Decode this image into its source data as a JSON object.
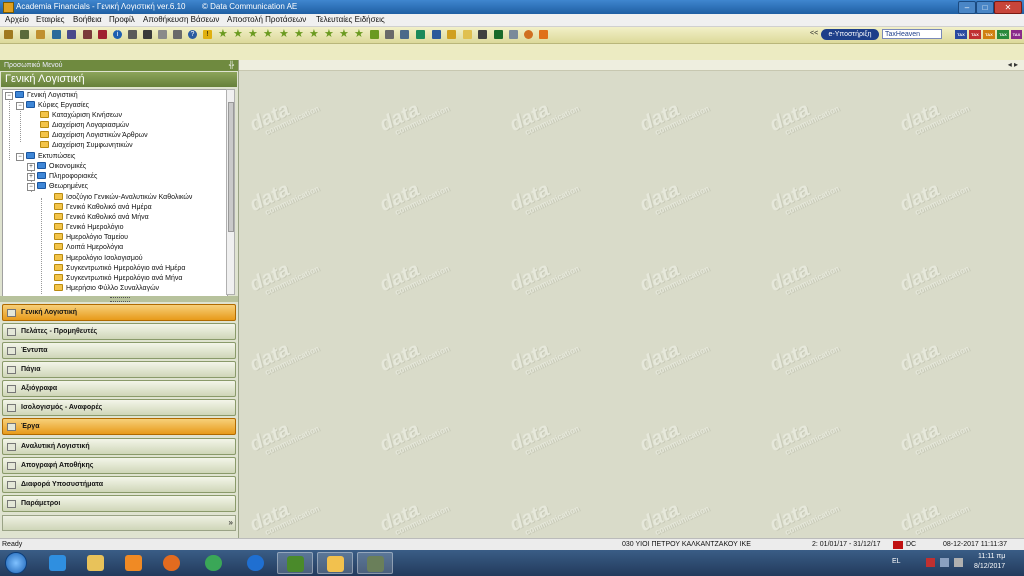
{
  "window": {
    "title": "Academia Financials - Γενική Λογιστική ver.6.10",
    "copyright": "© Data Communication AE",
    "buttons": {
      "minimize": "–",
      "maximize": "□",
      "close": "✕"
    }
  },
  "menu": [
    "Αρχείο",
    "Εταιρίες",
    "Βοήθεια",
    "Προφίλ",
    "Αποθήκευση Βάσεων",
    "Αποστολή Προτάσεων",
    "Τελευταίες Ειδήσεις"
  ],
  "toolbar": {
    "back_label": "<<",
    "ehelp_label": "e-Υποστήριξη",
    "taxheaven_label": "TaxHeaven",
    "tax_badges": [
      "TAX",
      "TAX",
      "TAX",
      "TAX",
      "TAX"
    ]
  },
  "panel": {
    "caption": "Προσωπικό Μενού",
    "pin": "╬",
    "title": "Γενική Λογιστική"
  },
  "tree": [
    {
      "label": "Γενική Λογιστική",
      "level": 0,
      "icon": "folder-blue",
      "expander": "−"
    },
    {
      "label": "Κύριες Εργασίες",
      "level": 1,
      "icon": "folder-blue",
      "expander": "−"
    },
    {
      "label": "Καταχώριση Κινήσεων",
      "level": 2,
      "icon": "folder-yellow"
    },
    {
      "label": "Διαχείριση Λογαριασμών",
      "level": 2,
      "icon": "folder-yellow"
    },
    {
      "label": "Διαχείριση Λογιστικών Άρθρων",
      "level": 2,
      "icon": "folder-yellow"
    },
    {
      "label": "Διαχείριση Συμφωνητικών",
      "level": 2,
      "icon": "folder-yellow"
    },
    {
      "label": "Εκτυπώσεις",
      "level": 1,
      "icon": "folder-blue",
      "expander": "−"
    },
    {
      "label": "Οικονομικές",
      "level": 2,
      "icon": "folder-blue",
      "expander": "+"
    },
    {
      "label": "Πληροφοριακές",
      "level": 2,
      "icon": "folder-blue",
      "expander": "+"
    },
    {
      "label": "Θεωρημένες",
      "level": 2,
      "icon": "folder-blue",
      "expander": "−"
    },
    {
      "label": "Ισοζύγιο Γενικών-Αναλυτικών Καθολικών",
      "level": 3,
      "icon": "folder-yellow"
    },
    {
      "label": "Γενικό Καθολικό ανά Ημέρα",
      "level": 3,
      "icon": "folder-yellow"
    },
    {
      "label": "Γενικό Καθολικό ανά Μήνα",
      "level": 3,
      "icon": "folder-yellow"
    },
    {
      "label": "Γενικό Ημερολόγιο",
      "level": 3,
      "icon": "folder-yellow"
    },
    {
      "label": "Ημερολόγιο Ταμείου",
      "level": 3,
      "icon": "folder-yellow"
    },
    {
      "label": "Λοιπά Ημερολόγια",
      "level": 3,
      "icon": "folder-yellow"
    },
    {
      "label": "Ημερολόγιο Ισολογισμού",
      "level": 3,
      "icon": "folder-yellow"
    },
    {
      "label": "Συγκεντρωτικό Ημερολόγιο ανά Ημέρα",
      "level": 3,
      "icon": "folder-yellow"
    },
    {
      "label": "Συγκεντρωτικό Ημερολόγιο ανά Μήνα",
      "level": 3,
      "icon": "folder-yellow"
    },
    {
      "label": "Ημερήσιο Φύλλο Συναλλαγών",
      "level": 3,
      "icon": "folder-yellow"
    }
  ],
  "nav_buttons": [
    {
      "label": "Γενική Λογιστική",
      "active": true
    },
    {
      "label": "Πελάτες - Προμηθευτές",
      "active": false
    },
    {
      "label": "Έντυπα",
      "active": false
    },
    {
      "label": "Πάγια",
      "active": false
    },
    {
      "label": "Αξιόγραφα",
      "active": false
    },
    {
      "label": "Ισολογισμός - Αναφορές",
      "active": false
    },
    {
      "label": "Έργα",
      "active": true
    },
    {
      "label": "Αναλυτική Λογιστική",
      "active": false
    },
    {
      "label": "Απογραφή Αποθήκης",
      "active": false
    },
    {
      "label": "Διαφορά Υποσυστήματα",
      "active": false
    },
    {
      "label": "Παράμετροι",
      "active": false
    }
  ],
  "main": {
    "nav_arrows": "◂ ▸",
    "watermark_big": "data",
    "watermark_small": "communication"
  },
  "status": {
    "ready": "Ready",
    "company": "030  ΥΙΟΙ ΠΕΤΡΟΥ ΚΑΛΚΑΝΤΖΑΚΟΥ ΙΚΕ",
    "period": "2: 01/01/17 - 31/12/17",
    "dc": "DC",
    "datetime": "08-12-2017 11:11:37"
  },
  "taskbar": {
    "lang": "EL",
    "time": "11:11 πμ",
    "date": "8/12/2017",
    "apps": [
      {
        "name": "internet-explorer-icon",
        "color": "#2f8fe0"
      },
      {
        "name": "file-explorer-icon",
        "color": "#e8c25a"
      },
      {
        "name": "media-player-icon",
        "color": "#f08a24"
      },
      {
        "name": "firefox-icon",
        "color": "#e36b1f"
      },
      {
        "name": "chrome-icon",
        "color": "#3aa757"
      },
      {
        "name": "teamviewer-icon",
        "color": "#1f6fd1"
      },
      {
        "name": "academia-icon",
        "color": "#4a8a2a"
      },
      {
        "name": "folder-app-icon",
        "color": "#f2c14e"
      },
      {
        "name": "academia-financials-icon",
        "color": "#6a7f5a"
      }
    ]
  },
  "colors": {
    "accent_orange": "#e89a1a",
    "panel_green": "#6f8a3f",
    "titlebar_blue": "#1f5fa3"
  }
}
